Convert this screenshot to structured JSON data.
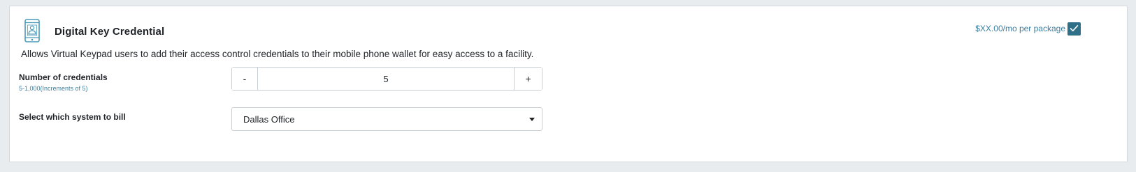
{
  "product": {
    "title": "Digital Key Credential",
    "price": "$XX.00/mo per package",
    "selected": true,
    "description": "Allows Virtual Keypad users to add their access control credentials to their mobile phone wallet for easy access to a facility.",
    "icon": "mobile-phone-icon"
  },
  "credentials": {
    "label": "Number of credentials",
    "hint": "5-1,000(Increments of 5)",
    "decrement_label": "-",
    "increment_label": "+",
    "value": "5"
  },
  "billing": {
    "label": "Select which system to bill",
    "selected": "Dallas Office"
  },
  "colors": {
    "accent": "#2f6f88",
    "link": "#3d7fa0",
    "icon": "#4a9ab8"
  }
}
